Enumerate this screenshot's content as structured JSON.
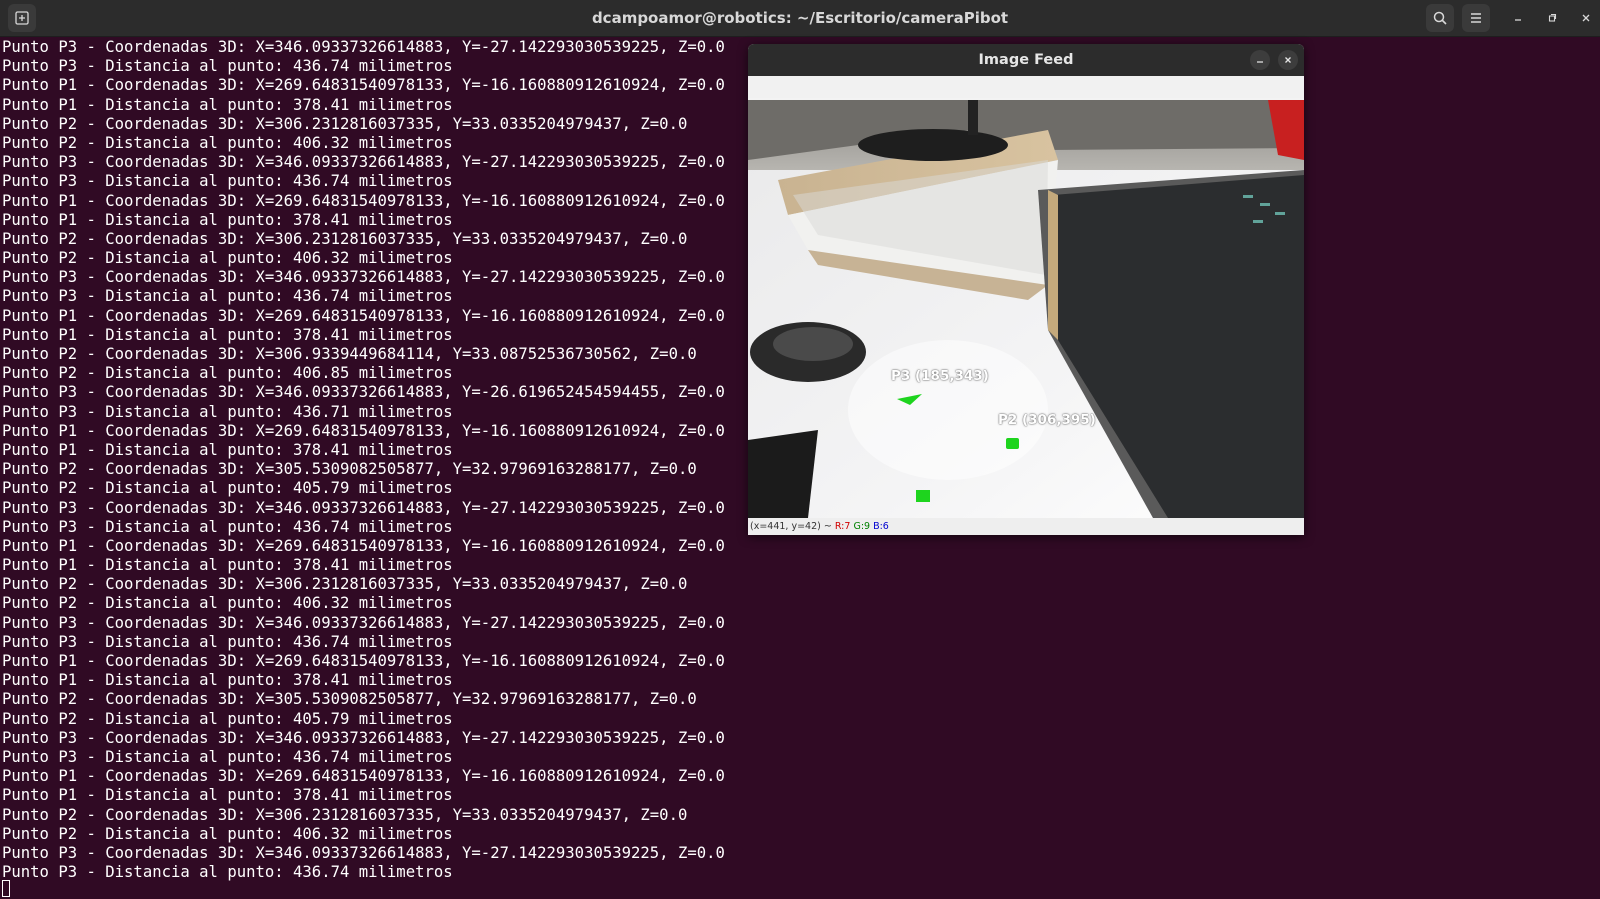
{
  "window": {
    "title": "dcampoamor@robotics: ~/Escritorio/cameraPibot",
    "new_tab_icon": "new-tab-icon",
    "buttons": [
      "search-icon",
      "menu-icon",
      "minimize-icon",
      "maximize-icon",
      "close-icon"
    ]
  },
  "terminal": {
    "background": "#300a24",
    "lines": [
      "Punto P3 - Coordenadas 3D: X=346.09337326614883, Y=-27.142293030539225, Z=0.0",
      "Punto P3 - Distancia al punto: 436.74 milimetros",
      "Punto P1 - Coordenadas 3D: X=269.64831540978133, Y=-16.160880912610924, Z=0.0",
      "Punto P1 - Distancia al punto: 378.41 milimetros",
      "Punto P2 - Coordenadas 3D: X=306.2312816037335, Y=33.0335204979437, Z=0.0",
      "Punto P2 - Distancia al punto: 406.32 milimetros",
      "Punto P3 - Coordenadas 3D: X=346.09337326614883, Y=-27.142293030539225, Z=0.0",
      "Punto P3 - Distancia al punto: 436.74 milimetros",
      "Punto P1 - Coordenadas 3D: X=269.64831540978133, Y=-16.160880912610924, Z=0.0",
      "Punto P1 - Distancia al punto: 378.41 milimetros",
      "Punto P2 - Coordenadas 3D: X=306.2312816037335, Y=33.0335204979437, Z=0.0",
      "Punto P2 - Distancia al punto: 406.32 milimetros",
      "Punto P3 - Coordenadas 3D: X=346.09337326614883, Y=-27.142293030539225, Z=0.0",
      "Punto P3 - Distancia al punto: 436.74 milimetros",
      "Punto P1 - Coordenadas 3D: X=269.64831540978133, Y=-16.160880912610924, Z=0.0",
      "Punto P1 - Distancia al punto: 378.41 milimetros",
      "Punto P2 - Coordenadas 3D: X=306.9339449684114, Y=33.08752536730562, Z=0.0",
      "Punto P2 - Distancia al punto: 406.85 milimetros",
      "Punto P3 - Coordenadas 3D: X=346.09337326614883, Y=-26.619652454594455, Z=0.0",
      "Punto P3 - Distancia al punto: 436.71 milimetros",
      "Punto P1 - Coordenadas 3D: X=269.64831540978133, Y=-16.160880912610924, Z=0.0",
      "Punto P1 - Distancia al punto: 378.41 milimetros",
      "Punto P2 - Coordenadas 3D: X=305.5309082505877, Y=32.97969163288177, Z=0.0",
      "Punto P2 - Distancia al punto: 405.79 milimetros",
      "Punto P3 - Coordenadas 3D: X=346.09337326614883, Y=-27.142293030539225, Z=0.0",
      "Punto P3 - Distancia al punto: 436.74 milimetros",
      "Punto P1 - Coordenadas 3D: X=269.64831540978133, Y=-16.160880912610924, Z=0.0",
      "Punto P1 - Distancia al punto: 378.41 milimetros",
      "Punto P2 - Coordenadas 3D: X=306.2312816037335, Y=33.0335204979437, Z=0.0",
      "Punto P2 - Distancia al punto: 406.32 milimetros",
      "Punto P3 - Coordenadas 3D: X=346.09337326614883, Y=-27.142293030539225, Z=0.0",
      "Punto P3 - Distancia al punto: 436.74 milimetros",
      "Punto P1 - Coordenadas 3D: X=269.64831540978133, Y=-16.160880912610924, Z=0.0",
      "Punto P1 - Distancia al punto: 378.41 milimetros",
      "Punto P2 - Coordenadas 3D: X=305.5309082505877, Y=32.97969163288177, Z=0.0",
      "Punto P2 - Distancia al punto: 405.79 milimetros",
      "Punto P3 - Coordenadas 3D: X=346.09337326614883, Y=-27.142293030539225, Z=0.0",
      "Punto P3 - Distancia al punto: 436.74 milimetros",
      "Punto P1 - Coordenadas 3D: X=269.64831540978133, Y=-16.160880912610924, Z=0.0",
      "Punto P1 - Distancia al punto: 378.41 milimetros",
      "Punto P2 - Coordenadas 3D: X=306.2312816037335, Y=33.0335204979437, Z=0.0",
      "Punto P2 - Distancia al punto: 406.32 milimetros",
      "Punto P3 - Coordenadas 3D: X=346.09337326614883, Y=-27.142293030539225, Z=0.0",
      "Punto P3 - Distancia al punto: 436.74 milimetros"
    ]
  },
  "image_feed": {
    "title": "Image Feed",
    "labels": {
      "p3": "P3 (185,343)",
      "p2": "P2 (306,395)"
    },
    "status": {
      "coords": "(x=441, y=42) ~",
      "r": "R:7",
      "g": "G:9",
      "b": "B:6"
    },
    "marker_color": "#1ed41e"
  }
}
